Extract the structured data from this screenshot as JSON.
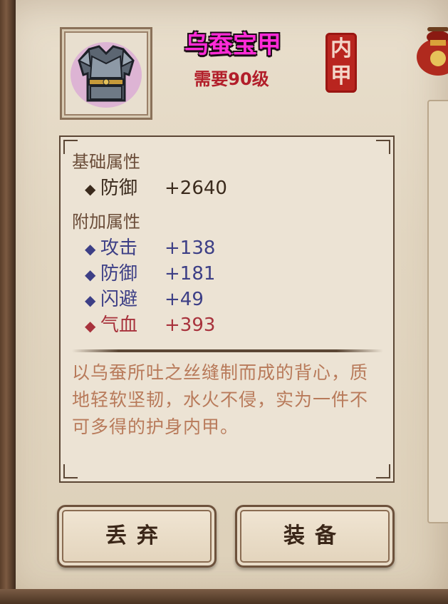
{
  "item": {
    "name": "乌蚕宝甲",
    "level_requirement": "需要90级",
    "slot_seal": "内甲",
    "icon": "armor-vest-icon"
  },
  "base_attributes": {
    "title": "基础属性",
    "stats": [
      {
        "name": "防御",
        "value": "+2640",
        "color": "#3a2a1c"
      }
    ]
  },
  "extra_attributes": {
    "title": "附加属性",
    "stats": [
      {
        "name": "攻击",
        "value": "+138",
        "color": "#3d3f86"
      },
      {
        "name": "防御",
        "value": "+181",
        "color": "#3d3f86"
      },
      {
        "name": "闪避",
        "value": "+49",
        "color": "#3d3f86"
      },
      {
        "name": "气血",
        "value": "+393",
        "color": "#a8323c"
      }
    ]
  },
  "description": "以乌蚕所吐之丝缝制而成的背心，质地轻软坚韧，水火不侵，实为一件不可多得的护身内甲。",
  "buttons": {
    "discard": "丢弃",
    "equip": "装备"
  },
  "colors": {
    "item_name": "#ff2bd8",
    "requirement": "#b21e2a",
    "seal": "#b9251f",
    "description": "#b87a5a"
  }
}
